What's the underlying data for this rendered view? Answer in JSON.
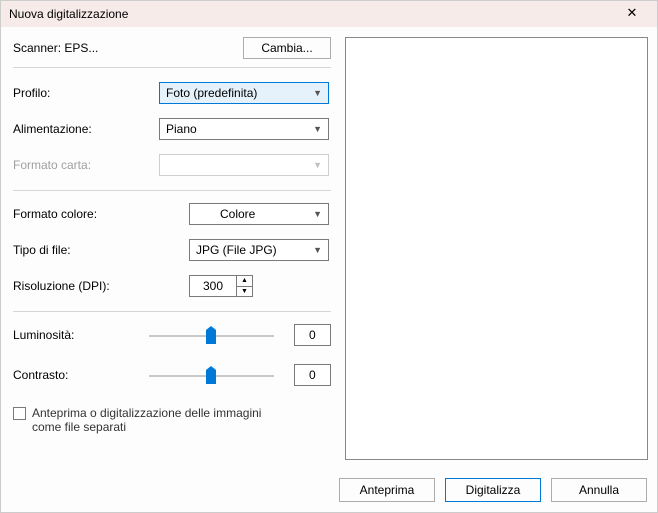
{
  "window": {
    "title": "Nuova digitalizzazione"
  },
  "scanner": {
    "label": "Scanner: EPS...",
    "change_btn": "Cambia..."
  },
  "profile": {
    "label": "Profilo:",
    "value": "Foto (predefinita)"
  },
  "source": {
    "label": "Alimentazione:",
    "value": "Piano"
  },
  "paper": {
    "label": "Formato carta:",
    "value": ""
  },
  "colorfmt": {
    "label": "Formato colore:",
    "value": "Colore"
  },
  "filetype": {
    "label": "Tipo di file:",
    "value": "JPG (File JPG)"
  },
  "resolution": {
    "label": "Risoluzione (DPI):",
    "value": "300"
  },
  "brightness": {
    "label": "Luminosità:",
    "value": "0"
  },
  "contrast": {
    "label": "Contrasto:",
    "value": "0"
  },
  "checkbox": {
    "label": "Anteprima o digitalizzazione delle immagini come file separati"
  },
  "buttons": {
    "preview": "Anteprima",
    "scan": "Digitalizza",
    "cancel": "Annulla"
  }
}
